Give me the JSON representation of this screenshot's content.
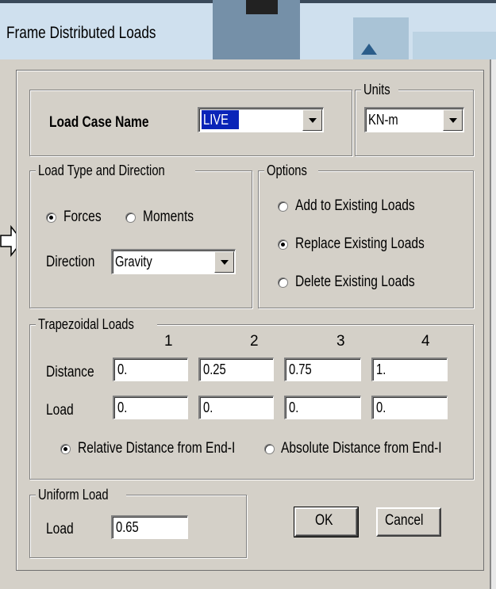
{
  "window": {
    "title": "Frame Distributed Loads"
  },
  "load_case": {
    "label": "Load Case Name",
    "value": "LIVE"
  },
  "units": {
    "legend": "Units",
    "value": "KN-m"
  },
  "load_type": {
    "legend": "Load Type and Direction",
    "forces_label": "Forces",
    "forces_selected": true,
    "moments_label": "Moments",
    "moments_selected": false,
    "direction_label": "Direction",
    "direction_value": "Gravity"
  },
  "options": {
    "legend": "Options",
    "add_label": "Add to Existing Loads",
    "replace_label": "Replace Existing Loads",
    "delete_label": "Delete Existing Loads",
    "selected": "replace"
  },
  "trapezoidal": {
    "legend": "Trapezoidal Loads",
    "columns": [
      "1",
      "2",
      "3",
      "4"
    ],
    "distance_label": "Distance",
    "distances": [
      "0.",
      "0.25",
      "0.75",
      "1."
    ],
    "load_label": "Load",
    "loads": [
      "0.",
      "0.",
      "0.",
      "0."
    ],
    "relative_label": "Relative Distance from End-I",
    "absolute_label": "Absolute Distance from End-I",
    "selected": "relative"
  },
  "uniform": {
    "legend": "Uniform Load",
    "load_label": "Load",
    "load_value": "0.65"
  },
  "buttons": {
    "ok": "OK",
    "cancel": "Cancel"
  },
  "icons": {
    "pointer": "right-arrow-icon",
    "dropdown": "chevron-down-icon"
  }
}
